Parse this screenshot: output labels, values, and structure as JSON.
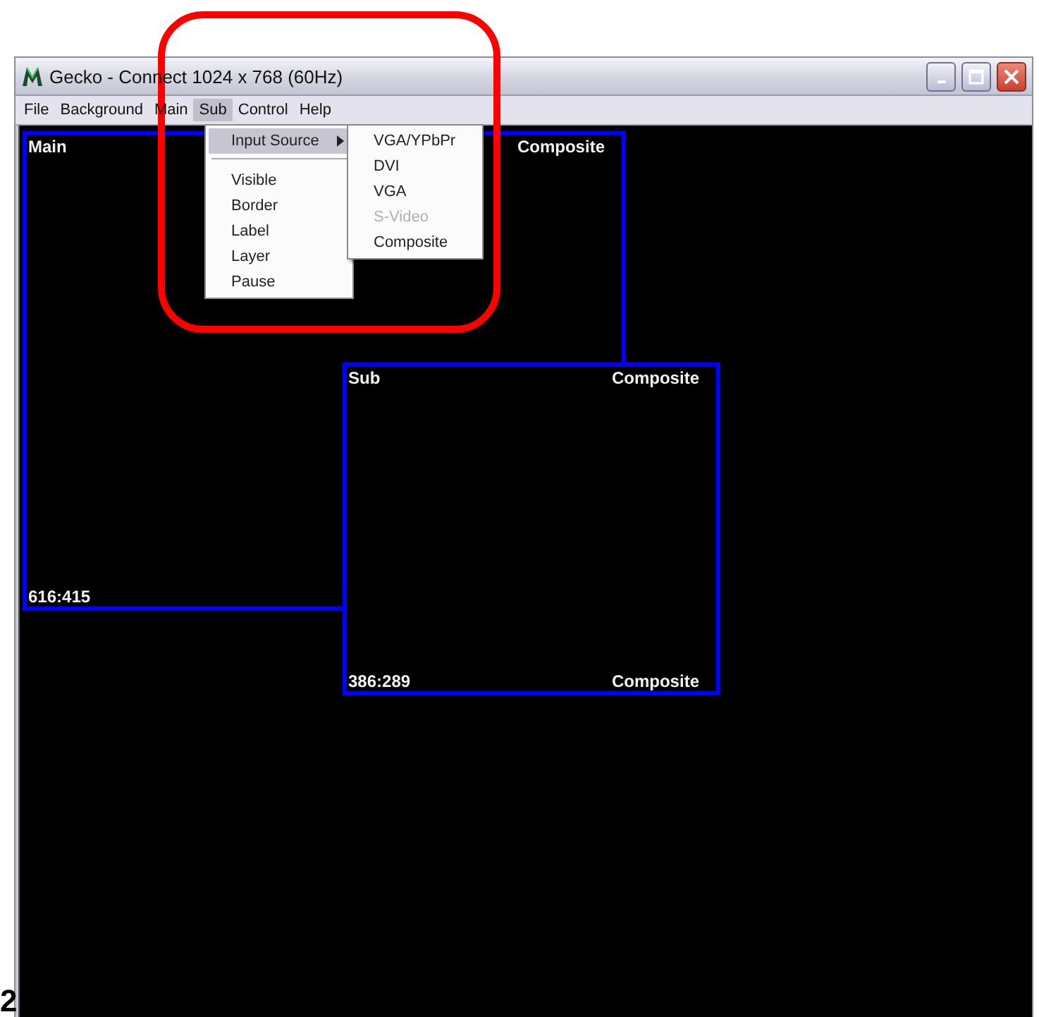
{
  "window": {
    "title": "Gecko - Connect 1024 x 768 (60Hz)"
  },
  "menu_bar": [
    {
      "label": "File",
      "selected": false
    },
    {
      "label": "Background",
      "selected": false
    },
    {
      "label": "Main",
      "selected": false
    },
    {
      "label": "Sub",
      "selected": true
    },
    {
      "label": "Control",
      "selected": false
    },
    {
      "label": "Help",
      "selected": false
    }
  ],
  "sub_menu": [
    {
      "kind": "submenu",
      "label": "Input Source",
      "selected": true
    },
    {
      "kind": "separator"
    },
    {
      "kind": "item",
      "label": "Visible",
      "selected": false
    },
    {
      "kind": "item",
      "label": "Border",
      "selected": false
    },
    {
      "kind": "item",
      "label": "Label",
      "selected": false
    },
    {
      "kind": "item",
      "label": "Layer",
      "selected": false
    },
    {
      "kind": "item",
      "label": "Pause",
      "selected": false
    }
  ],
  "input_source_menu": [
    {
      "label": "VGA/YPbPr",
      "disabled": false
    },
    {
      "label": "DVI",
      "disabled": false
    },
    {
      "label": "VGA",
      "disabled": false
    },
    {
      "label": "S-Video",
      "disabled": true
    },
    {
      "label": "Composite",
      "disabled": false
    }
  ],
  "windows": [
    {
      "name": "Main",
      "source_top": "Composite",
      "size": "616:415"
    },
    {
      "name": "Sub",
      "source_top": "Composite",
      "size": "386:289",
      "source_bottom": "Composite"
    }
  ],
  "page_marker": "2"
}
